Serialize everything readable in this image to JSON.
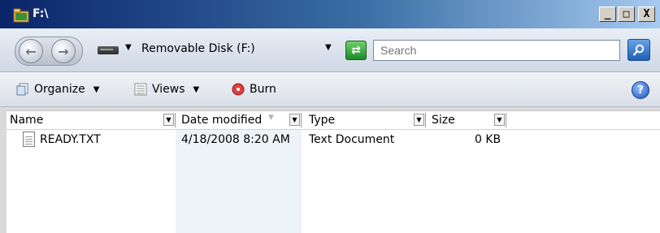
{
  "window": {
    "title": "F:\\",
    "minimize_label": "_",
    "maximize_label": "□",
    "close_label": "X"
  },
  "addressbar": {
    "back_icon": "back-arrow-icon",
    "forward_icon": "forward-arrow-icon",
    "location": "Removable Disk (F:)",
    "search_placeholder": "Search"
  },
  "commandbar": {
    "organize_label": "Organize",
    "views_label": "Views",
    "burn_label": "Burn",
    "help_label": "?"
  },
  "columns": [
    {
      "label": "Name"
    },
    {
      "label": "Date modified"
    },
    {
      "label": "Type"
    },
    {
      "label": "Size"
    }
  ],
  "files": [
    {
      "name": "READY.TXT",
      "date_modified": "4/18/2008 8:20 AM",
      "type": "Text Document",
      "size": "0 KB"
    }
  ],
  "colors": {
    "title_gradient_start": "#0a246a",
    "title_gradient_end": "#a6caf0",
    "sorted_column_bg": "#eef3f8"
  }
}
